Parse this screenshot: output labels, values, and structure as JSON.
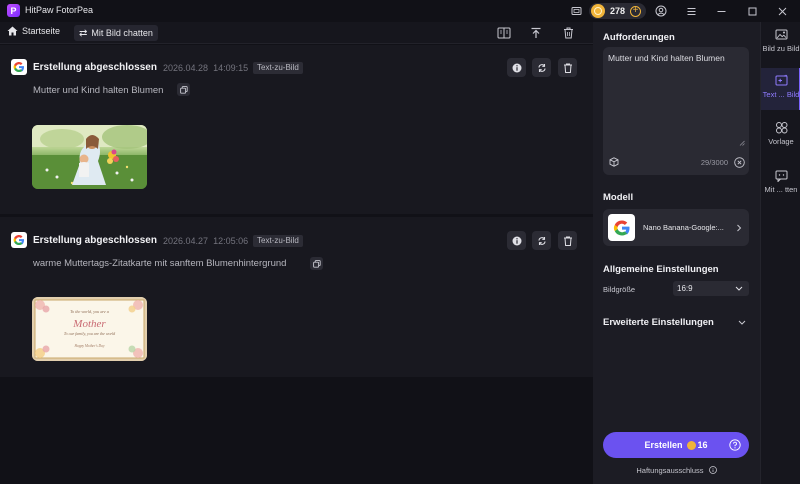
{
  "app": {
    "title": "HitPaw FotorPea",
    "credits": "278"
  },
  "toolbar": {
    "home_label": "Startseite",
    "chat_label": "Mit Bild chatten"
  },
  "results": [
    {
      "title": "Erstellung abgeschlossen",
      "date": "2026.04.28",
      "time": "14:09:15",
      "tag": "Text-zu-Bild",
      "prompt": "Mutter und Kind halten Blumen"
    },
    {
      "title": "Erstellung abgeschlossen",
      "date": "2026.04.27",
      "time": "12:05:06",
      "tag": "Text-zu-Bild",
      "prompt": "warme Muttertags-Zitatkarte mit sanftem Blumenhintergrund",
      "card_line1": "To the world, you are a",
      "card_main": "Mother",
      "card_line2": "To our family, you are the world",
      "card_footer": "Happy Mother's Day"
    }
  ],
  "panel": {
    "prompt_heading": "Aufforderungen",
    "prompt_value": "Mutter und Kind halten Blumen",
    "char_count": "29/3000",
    "model_heading": "Modell",
    "model_name": "Nano Banana-Google:...",
    "general_heading": "Allgemeine Einstellungen",
    "size_label": "Bildgröße",
    "size_value": "16:9",
    "advanced_heading": "Erweiterte Einstellungen",
    "create_label": "Erstellen",
    "create_cost": "16",
    "disclaimer": "Haftungsausschluss"
  },
  "nav": [
    {
      "label": "Bild zu Bild",
      "icon": "image-icon"
    },
    {
      "label": "Text ... Bild",
      "icon": "text-to-image-icon",
      "active": true
    },
    {
      "label": "Vorlage",
      "icon": "template-icon"
    },
    {
      "label": "Mit ... tten",
      "icon": "chat-image-icon"
    }
  ],
  "colors": {
    "accent": "#6b52f0",
    "coin": "#f0b43a",
    "background": "#111117"
  }
}
